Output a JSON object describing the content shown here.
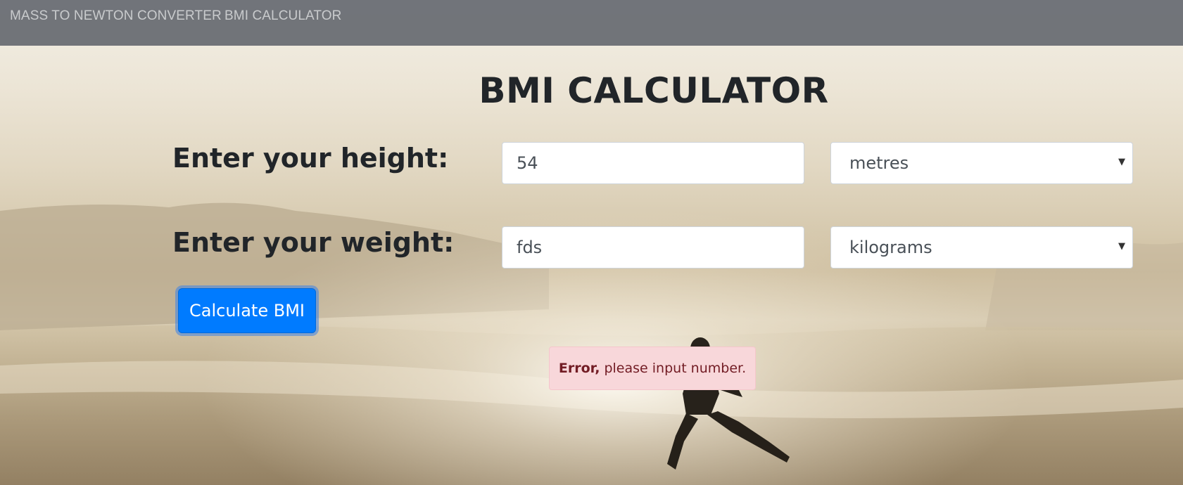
{
  "navbar": {
    "links": [
      {
        "label": "MASS TO NEWTON CONVERTER"
      },
      {
        "label": "BMI CALCULATOR"
      }
    ]
  },
  "page_title": "BMI CALCULATOR",
  "form": {
    "height": {
      "label": "Enter your height:",
      "value": "54",
      "unit": "metres"
    },
    "weight": {
      "label": "Enter your weight:",
      "value": "fds",
      "unit": "kilograms"
    },
    "submit_label": "Calculate BMI"
  },
  "alert": {
    "strong": "Error,",
    "message": "please input number."
  },
  "colors": {
    "navbar": "#6c7076",
    "button": "#007bff",
    "alert_bg": "#f8d7da",
    "alert_text": "#721c24"
  }
}
